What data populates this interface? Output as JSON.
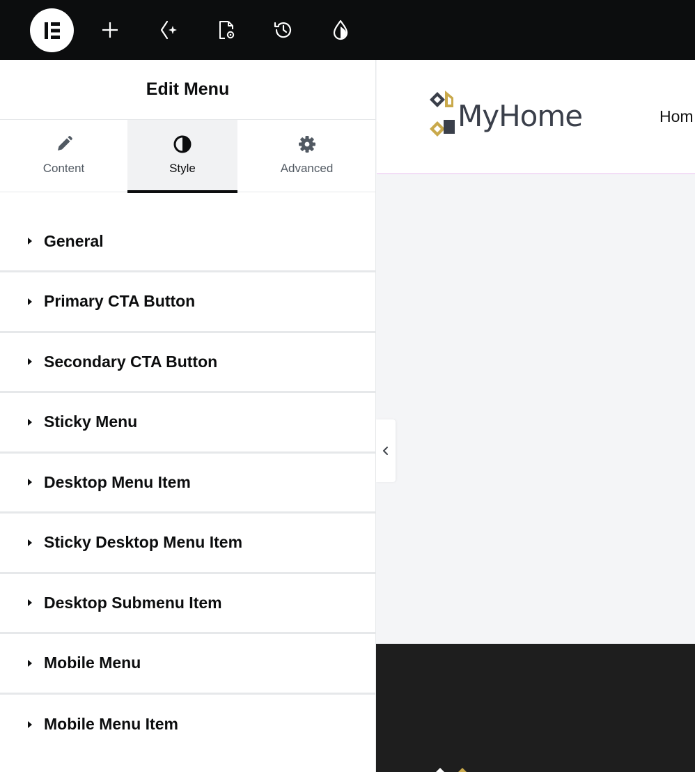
{
  "toolbar": {
    "icons": [
      "elementor-logo-icon",
      "plus-icon",
      "ai-sparkle-icon",
      "page-settings-icon",
      "history-icon",
      "site-settings-droplet-icon"
    ]
  },
  "panel": {
    "title": "Edit Menu",
    "tabs": [
      {
        "label": "Content",
        "icon": "pencil-icon",
        "active": false
      },
      {
        "label": "Style",
        "icon": "contrast-icon",
        "active": true
      },
      {
        "label": "Advanced",
        "icon": "gear-icon",
        "active": false
      }
    ],
    "sections": [
      {
        "label": "General"
      },
      {
        "label": "Primary CTA Button"
      },
      {
        "label": "Secondary CTA Button"
      },
      {
        "label": "Sticky Menu"
      },
      {
        "label": "Desktop Menu Item"
      },
      {
        "label": "Sticky Desktop Menu Item"
      },
      {
        "label": "Desktop Submenu Item"
      },
      {
        "label": "Mobile Menu"
      },
      {
        "label": "Mobile Menu Item"
      }
    ]
  },
  "preview": {
    "logo_text": "MyHome",
    "nav_first": "Hom",
    "colors": {
      "logo_dark": "#3a3f4a",
      "logo_gold": "#c9a94b",
      "header_border": "#e8bdee",
      "footer_bg": "#1e1e1e"
    }
  }
}
